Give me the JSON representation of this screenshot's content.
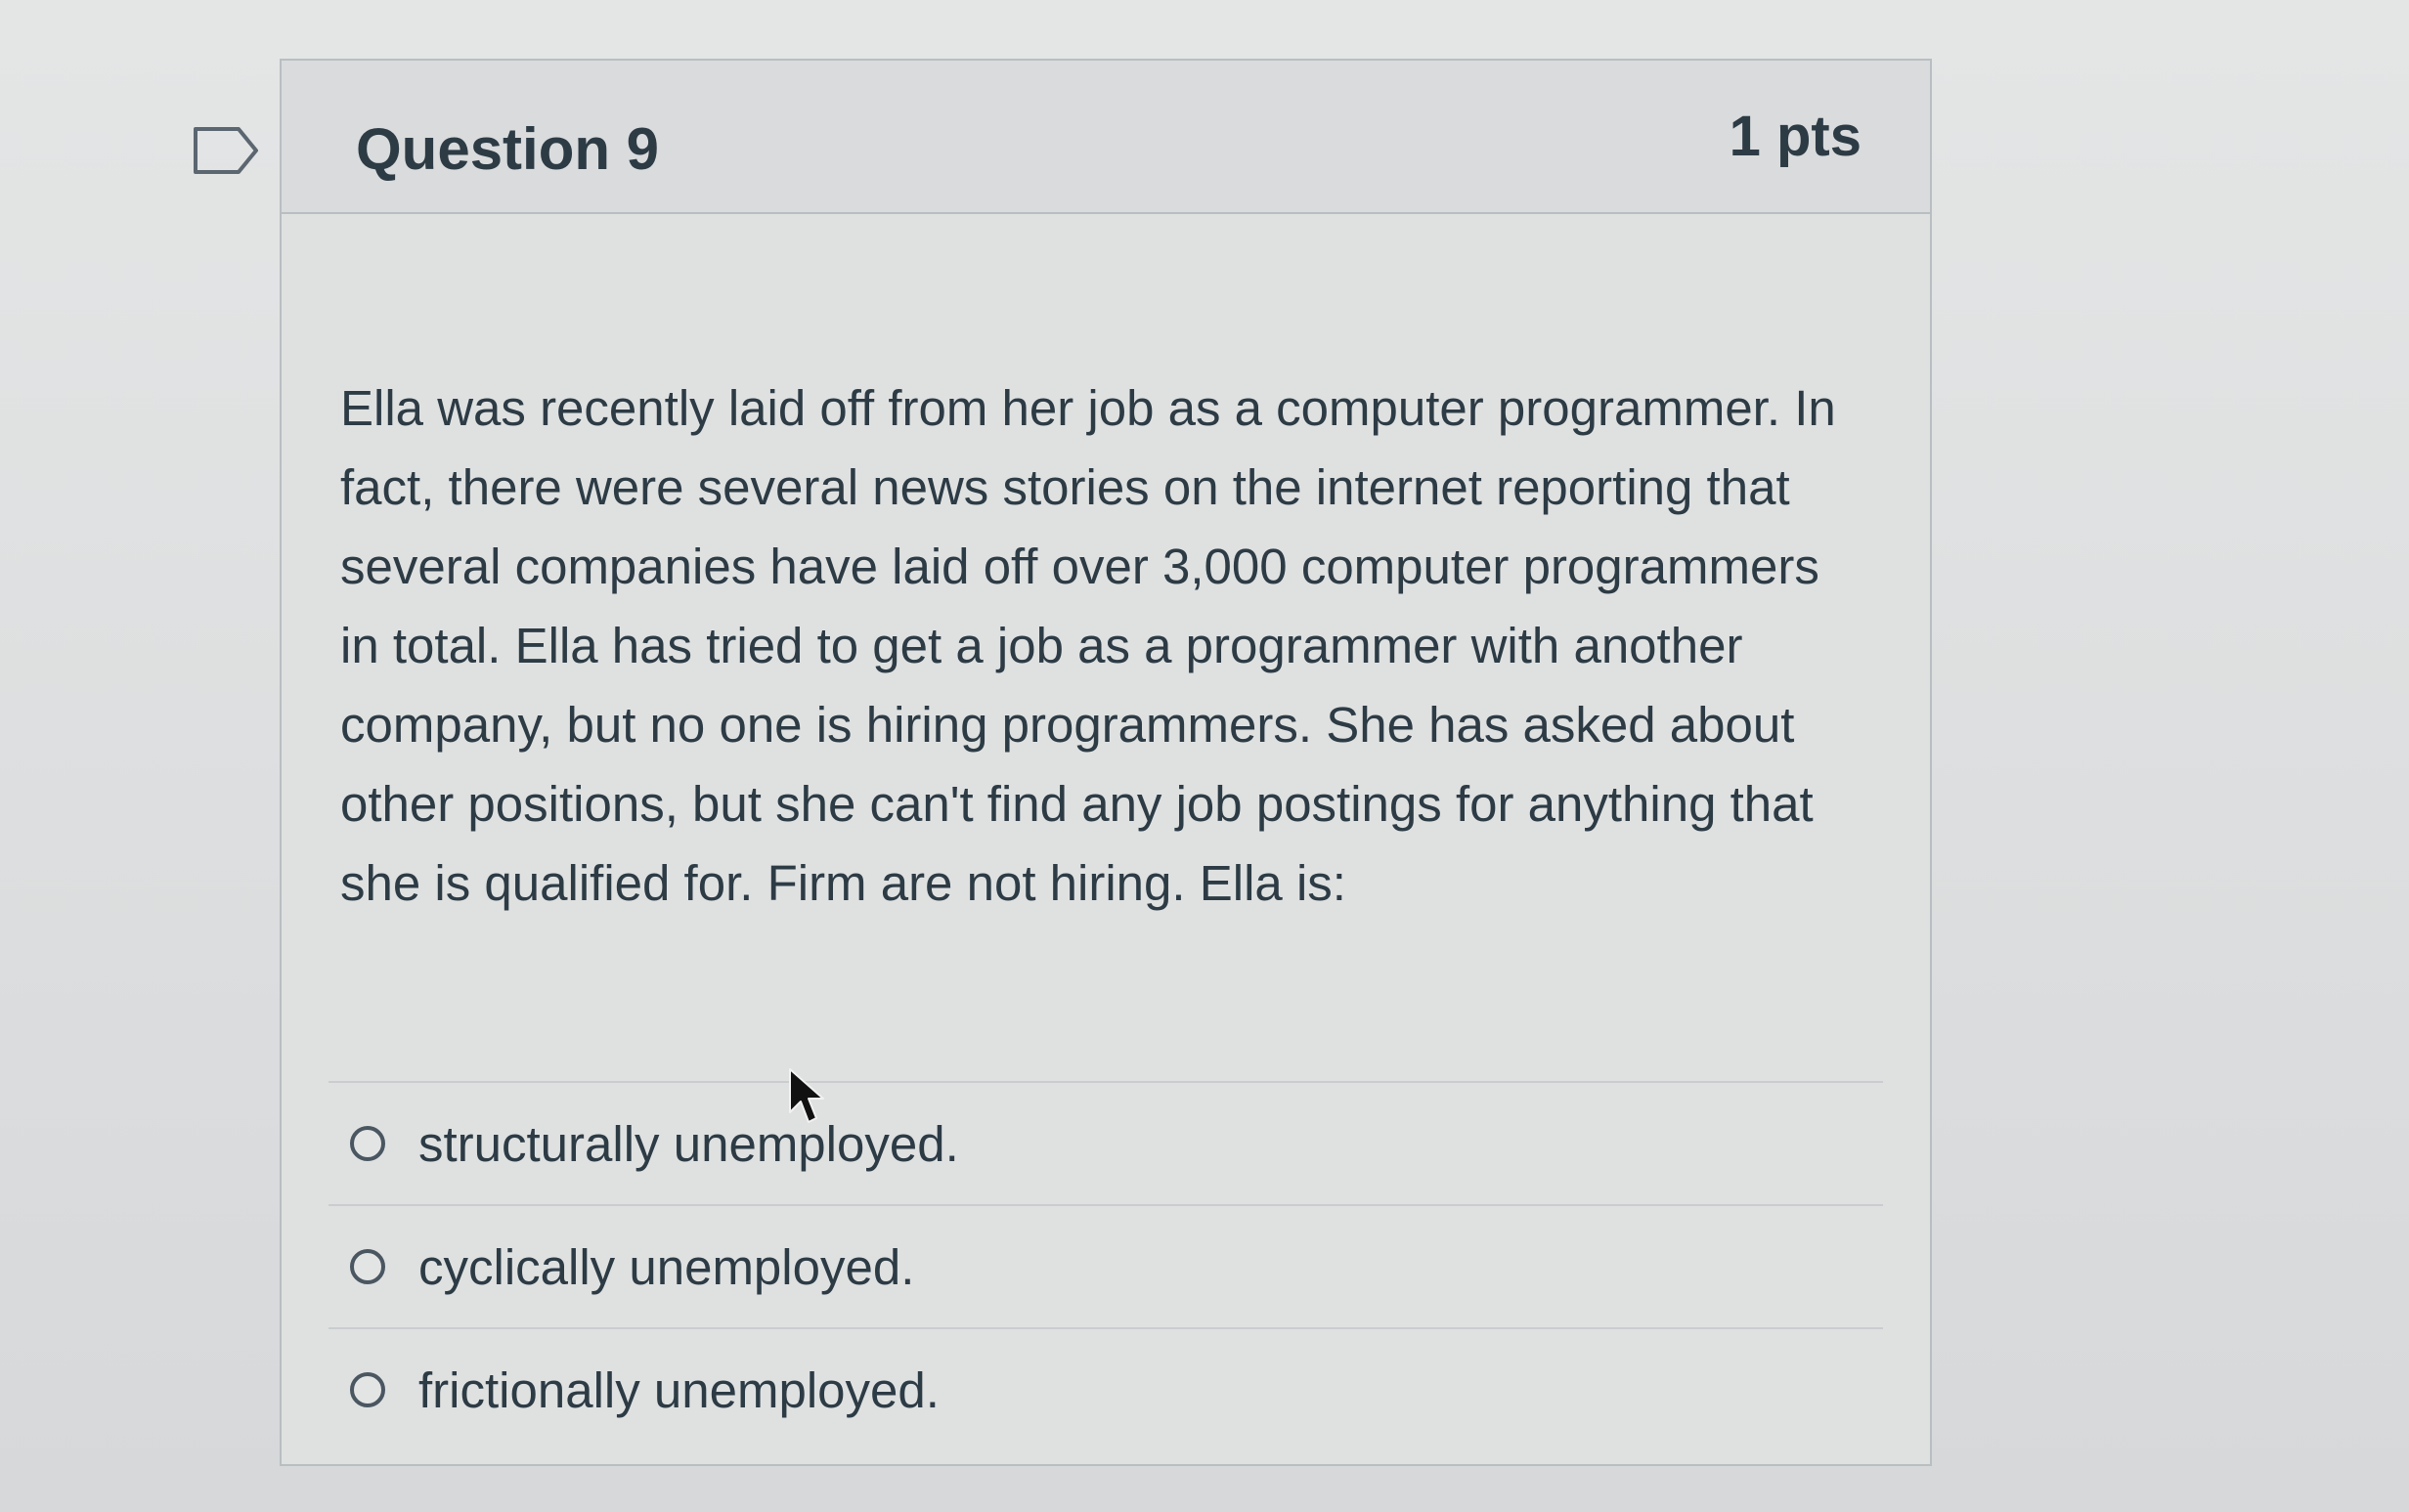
{
  "question": {
    "title": "Question 9",
    "points": "1 pts",
    "text": "Ella was recently laid off from her job as a computer programmer. In fact, there were several news stories on the internet reporting that several companies have laid off over 3,000 computer programmers in total. Ella has tried to get a job as a programmer with another company, but no one is hiring programmers. She has asked about other positions, but she can't find any job postings for anything that she is qualified for. Firm are not hiring. Ella is:",
    "answers": [
      {
        "label": "structurally unemployed."
      },
      {
        "label": "cyclically unemployed."
      },
      {
        "label": "frictionally unemployed."
      }
    ]
  },
  "icons": {
    "flag": "flag-question-icon",
    "cursor": "mouse-pointer-icon",
    "radio": "radio-button-icon"
  },
  "colors": {
    "text": "#2d3b45",
    "border": "#b9bec2",
    "background": "#dfe1e1"
  }
}
